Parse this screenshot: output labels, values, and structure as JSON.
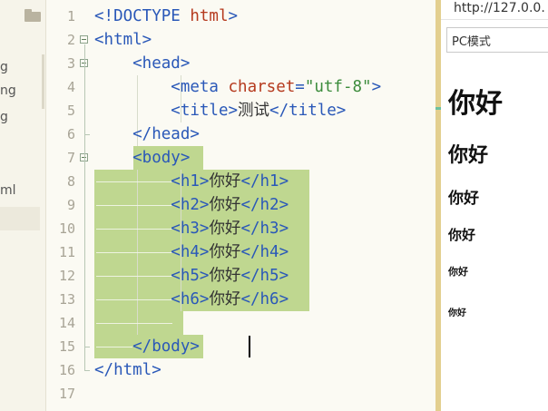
{
  "sidebar": {
    "fragments": [
      "g",
      "ng",
      "g",
      "ml"
    ]
  },
  "editor": {
    "line_numbers": [
      "1",
      "2",
      "3",
      "4",
      "5",
      "6",
      "7",
      "8",
      "9",
      "10",
      "11",
      "12",
      "13",
      "14",
      "15",
      "16",
      "17"
    ],
    "lines": [
      {
        "tokens": [
          {
            "k": "tag",
            "t": "<!DOCTYPE "
          },
          {
            "k": "attr",
            "t": "html"
          },
          {
            "k": "tag",
            "t": ">"
          }
        ]
      },
      {
        "tokens": [
          {
            "k": "tag",
            "t": "<html>"
          }
        ]
      },
      {
        "tokens": [
          {
            "k": "tag",
            "t": "    <head>"
          }
        ]
      },
      {
        "tokens": [
          {
            "k": "tag",
            "t": "        <meta "
          },
          {
            "k": "attr",
            "t": "charset"
          },
          {
            "k": "tag",
            "t": "="
          },
          {
            "k": "str",
            "t": "\"utf-8\""
          },
          {
            "k": "tag",
            "t": ">"
          }
        ]
      },
      {
        "tokens": [
          {
            "k": "tag",
            "t": "        <title>"
          },
          {
            "k": "text",
            "t": "测试"
          },
          {
            "k": "tag",
            "t": "</title>"
          }
        ]
      },
      {
        "tokens": [
          {
            "k": "tag",
            "t": "    </head>"
          }
        ]
      },
      {
        "tokens": [
          {
            "k": "tag",
            "t": "    <body>"
          }
        ]
      },
      {
        "tokens": [
          {
            "k": "tag",
            "t": "        <h1>"
          },
          {
            "k": "text",
            "t": "你好"
          },
          {
            "k": "tag",
            "t": "</h1>"
          }
        ]
      },
      {
        "tokens": [
          {
            "k": "tag",
            "t": "        <h2>"
          },
          {
            "k": "text",
            "t": "你好"
          },
          {
            "k": "tag",
            "t": "</h2>"
          }
        ]
      },
      {
        "tokens": [
          {
            "k": "tag",
            "t": "        <h3>"
          },
          {
            "k": "text",
            "t": "你好"
          },
          {
            "k": "tag",
            "t": "</h3>"
          }
        ]
      },
      {
        "tokens": [
          {
            "k": "tag",
            "t": "        <h4>"
          },
          {
            "k": "text",
            "t": "你好"
          },
          {
            "k": "tag",
            "t": "</h4>"
          }
        ]
      },
      {
        "tokens": [
          {
            "k": "tag",
            "t": "        <h5>"
          },
          {
            "k": "text",
            "t": "你好"
          },
          {
            "k": "tag",
            "t": "</h5>"
          }
        ]
      },
      {
        "tokens": [
          {
            "k": "tag",
            "t": "        <h6>"
          },
          {
            "k": "text",
            "t": "你好"
          },
          {
            "k": "tag",
            "t": "</h6>"
          }
        ]
      },
      {
        "tokens": []
      },
      {
        "tokens": [
          {
            "k": "tag",
            "t": "    </body>"
          }
        ]
      },
      {
        "tokens": [
          {
            "k": "tag",
            "t": "</html>"
          }
        ]
      },
      {
        "tokens": []
      }
    ]
  },
  "preview": {
    "url": "http://127.0.0.",
    "mode": "PC模式",
    "headings": [
      "你好",
      "你好",
      "你好",
      "你好",
      "你好",
      "你好"
    ]
  },
  "colors": {
    "selection": "#bfd790",
    "tag": "#2a58b8",
    "attr": "#b53a1e",
    "string": "#3c8c3c"
  }
}
